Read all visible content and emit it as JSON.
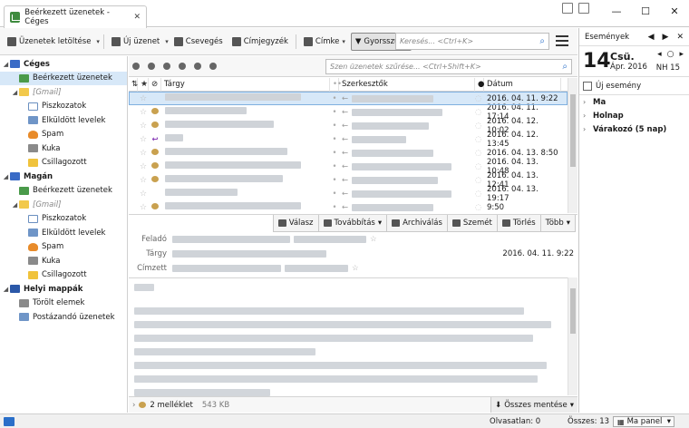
{
  "window": {
    "tab_title": "Beérkezett üzenetek - Céges"
  },
  "toolbar": {
    "get_messages": "Üzenetek letöltése",
    "new_message": "Új üzenet",
    "chat": "Csevegés",
    "address_book": "Címjegyzék",
    "tag": "Címke",
    "quick_filter": "Gyorsszűrő",
    "search_placeholder": "Keresés... <Ctrl+K>"
  },
  "folders": [
    {
      "label": "Céges",
      "type": "account",
      "level": 0,
      "bold": true
    },
    {
      "label": "Beérkezett üzenetek",
      "type": "inbox",
      "level": 1,
      "selected": true
    },
    {
      "label": "[Gmail]",
      "type": "folder",
      "level": 1,
      "italic": true
    },
    {
      "label": "Piszkozatok",
      "type": "doc",
      "level": 2
    },
    {
      "label": "Elküldött levelek",
      "type": "sent",
      "level": 2
    },
    {
      "label": "Spam",
      "type": "spam",
      "level": 2
    },
    {
      "label": "Kuka",
      "type": "trash",
      "level": 2
    },
    {
      "label": "Csillagozott",
      "type": "star",
      "level": 2
    },
    {
      "label": "Magán",
      "type": "account",
      "level": 0,
      "bold": true
    },
    {
      "label": "Beérkezett üzenetek",
      "type": "inbox",
      "level": 1
    },
    {
      "label": "[Gmail]",
      "type": "folder",
      "level": 1,
      "italic": true
    },
    {
      "label": "Piszkozatok",
      "type": "doc",
      "level": 2
    },
    {
      "label": "Elküldött levelek",
      "type": "sent",
      "level": 2
    },
    {
      "label": "Spam",
      "type": "spam",
      "level": 2
    },
    {
      "label": "Kuka",
      "type": "trash",
      "level": 2
    },
    {
      "label": "Csillagozott",
      "type": "star",
      "level": 2
    },
    {
      "label": "Helyi mappák",
      "type": "local",
      "level": 0,
      "bold": true
    },
    {
      "label": "Törölt elemek",
      "type": "trash",
      "level": 1
    },
    {
      "label": "Postázandó üzenetek",
      "type": "sent",
      "level": 1
    }
  ],
  "message_list": {
    "filter_placeholder": "Szen üzenetek szűrése... <Ctrl+Shift+K>",
    "columns": {
      "subject": "Tárgy",
      "author": "Szerkesztők",
      "date": "Dátum"
    },
    "rows": [
      {
        "date": "2016. 04. 11. 9:22",
        "attachment": false,
        "replied": false,
        "selected": true
      },
      {
        "date": "2016. 04. 11. 17:14",
        "attachment": true,
        "replied": false
      },
      {
        "date": "2016. 04. 12. 10:02",
        "attachment": true,
        "replied": false
      },
      {
        "date": "2016. 04. 12. 13:45",
        "attachment": false,
        "replied": true
      },
      {
        "date": "2016. 04. 13. 8:50",
        "attachment": true,
        "replied": false
      },
      {
        "date": "2016. 04. 13. 10:48",
        "attachment": true,
        "replied": false
      },
      {
        "date": "2016. 04. 13. 12:41",
        "attachment": true,
        "replied": false
      },
      {
        "date": "2016. 04. 13. 19:17",
        "attachment": false,
        "replied": false
      },
      {
        "date": "9:50",
        "attachment": true,
        "replied": false
      }
    ]
  },
  "header": {
    "buttons": {
      "reply": "Válasz",
      "forward": "Továbbítás",
      "archive": "Archiválás",
      "junk": "Szemét",
      "delete": "Törlés",
      "more": "Több"
    },
    "labels": {
      "from": "Feladó",
      "subject": "Tárgy",
      "to": "Címzett"
    },
    "date": "2016. 04. 11. 9:22"
  },
  "attachments": {
    "count": "2 melléklet",
    "size": "543 KB",
    "save_all": "Összes mentése"
  },
  "today_pane": {
    "title": "Események",
    "day": "14",
    "weekday": "Csü.",
    "month_year": "Ápr. 2016",
    "week": "NH 15",
    "new_event": "Új esemény",
    "groups": [
      "Ma",
      "Holnap",
      "Várakozó (5 nap)"
    ]
  },
  "statusbar": {
    "unread": "Olvasatlan: 0",
    "total": "Összes: 13",
    "panel": "Ma panel"
  }
}
